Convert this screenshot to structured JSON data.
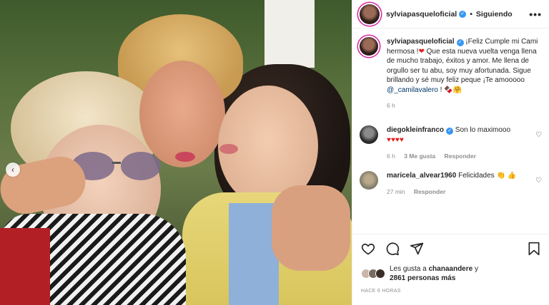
{
  "post": {
    "username": "sylviapasqueloficial",
    "follow_status": "Siguiendo",
    "caption_username": "sylviapasqueloficial",
    "caption_part1": "¡Feliz Cumple mi Cami hermosa !",
    "caption_part2": "Que esta nueva vuelta venga llena de mucho trabajo, éxitos y amor. Me llena de orgullo ser tu abu, soy muy afortunada. Sigue brillando y sé muy feliz peque ¡Te amooooo",
    "caption_mention": "@_camilavalero",
    "caption_end": "!",
    "caption_time": "6 h"
  },
  "comments": [
    {
      "username": "diegokleinfranco",
      "text": "Son lo maximooo",
      "emojis": "♥♥♥♥",
      "time": "6 h",
      "likes": "3 Me gusta",
      "reply": "Responder"
    },
    {
      "username": "maricela_alvear1960",
      "text": "Felicidades",
      "emojis": "👏 👍",
      "time": "27 min",
      "reply": "Responder"
    }
  ],
  "likes": {
    "prefix": "Les gusta a",
    "user": "chanaandere",
    "connector": "y",
    "others": "2861 personas más"
  },
  "timestamp": "HACE 6 HORAS",
  "colors": {
    "verified": "#3897f0",
    "link": "#00376b",
    "muted": "#8e8e8e"
  },
  "icons": [
    "more-icon",
    "heart-icon",
    "comment-icon",
    "share-icon",
    "bookmark-icon",
    "chevron-left-icon",
    "verified-icon"
  ]
}
